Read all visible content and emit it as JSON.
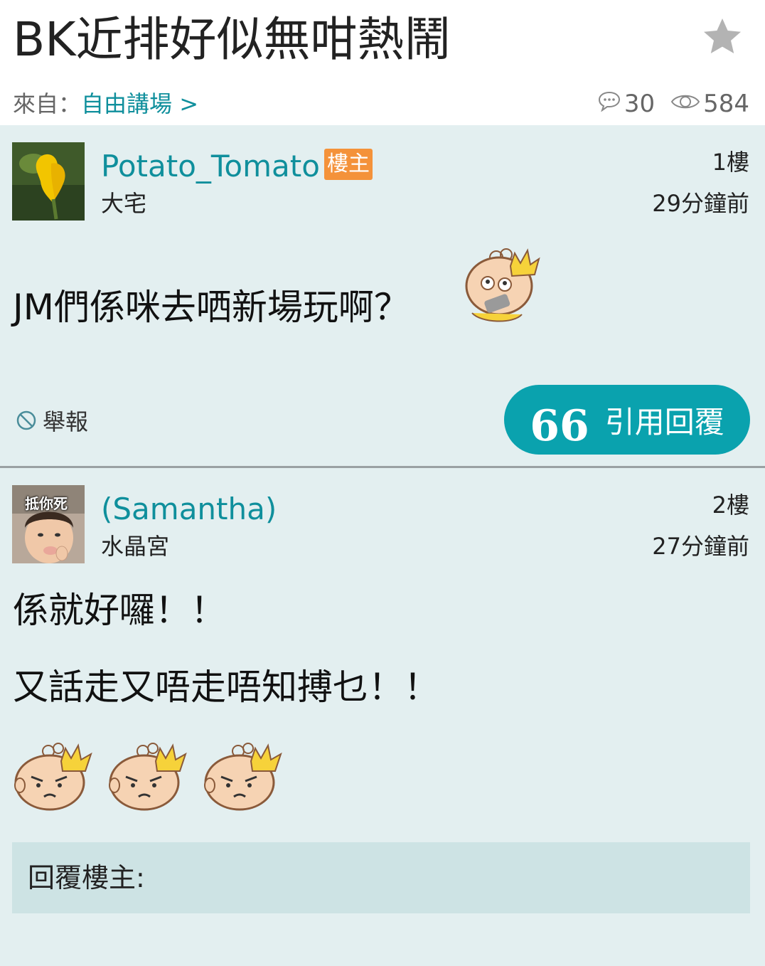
{
  "thread": {
    "title": "BK近排好似無咁熱鬧",
    "breadcrumb_prefix": "來自：",
    "board": "自由講場 >",
    "reply_count": "30",
    "view_count": "584",
    "icons": {
      "favorite": "star-icon",
      "replies": "comment-bubble-icon",
      "views": "eye-icon"
    }
  },
  "posts": [
    {
      "username": "Potato_Tomato",
      "badge": "樓主",
      "rank": "大宅",
      "floor": "1樓",
      "time": "29分鐘前",
      "content": [
        "JM們係咪去哂新場玩啊？"
      ],
      "report_label": "舉報",
      "quote_reply_label": "引用回覆",
      "quote_mark": "66"
    },
    {
      "username": "(Samantha)",
      "avatar_caption": "抵你死",
      "rank": "水晶宮",
      "floor": "2樓",
      "time": "27分鐘前",
      "content": [
        "係就好囉！！",
        "又話走又唔走唔知搏乜！！"
      ],
      "reply_to": "回覆樓主:"
    }
  ],
  "colors": {
    "accent": "#0aa2ae",
    "link": "#0f8f9c",
    "op_badge": "#f4923a",
    "post_bg": "#e3eff0",
    "quote_bg": "#cde3e4"
  }
}
